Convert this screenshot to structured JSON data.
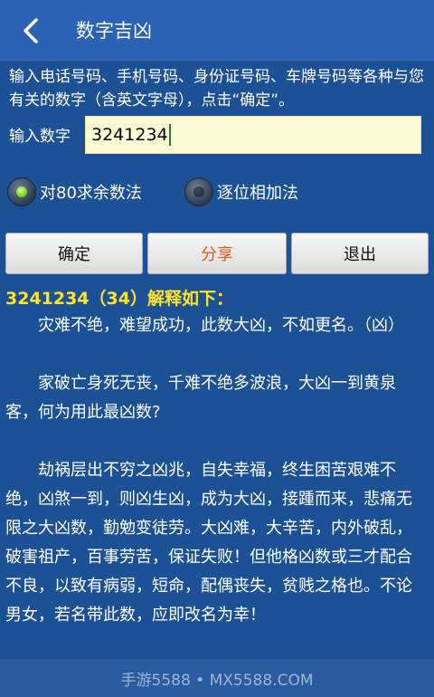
{
  "header": {
    "title": "数字吉凶",
    "back_icon": "chevron-left-icon"
  },
  "intro": "输入电话号码、手机号码、身份证号码、车牌号码等各种与您有关的数字（含英文字母），点击“确定”。",
  "input": {
    "label": "输入数字",
    "value": "3241234"
  },
  "options": [
    {
      "label": "对80求余数法",
      "selected": true
    },
    {
      "label": "逐位相加法",
      "selected": false
    }
  ],
  "buttons": {
    "confirm": "确定",
    "share": "分享",
    "exit": "退出"
  },
  "result": {
    "title": "3241234（34）解释如下：",
    "paragraphs": [
      "灾难不绝，难望成功，此数大凶，不如更名。（凶）",
      "家破亡身死无丧，千难不绝多波浪，大凶一到黄泉客，何为用此最凶数?",
      "劫祸层出不穷之凶兆，自失幸福，终生困苦艰难不绝，凶煞一到，则凶生凶，成为大凶，接踵而来，悲痛无限之大凶数，勤勉变徒劳。大凶难，大辛苦，内外破乱，破害祖产，百事劳苦，保证失败！但他格凶数或三才配合不良，以致有病弱，短命，配偶丧失，贫贱之格也。不论男女，若名带此数，应即改名为幸！"
    ]
  },
  "footer": "手游5588 • MX5588.COM",
  "colors": {
    "background": "#1d5196",
    "topbar": "#2b62b3",
    "result_title": "#ffe32b",
    "share_text": "#e8541a",
    "input_bg": "#fdfbd4"
  }
}
